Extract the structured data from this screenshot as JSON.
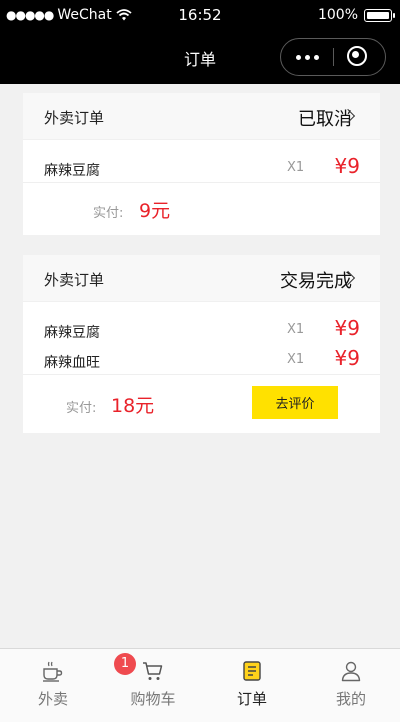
{
  "status_bar": {
    "carrier": "WeChat",
    "time": "16:52",
    "battery": "100%"
  },
  "nav": {
    "title": "订单"
  },
  "orders": [
    {
      "type": "外卖订单",
      "status": "已取消",
      "items": [
        {
          "name": "麻辣豆腐",
          "qty": "X1",
          "price": "¥9"
        }
      ],
      "paid_label": "实付:",
      "paid_amount": "9元"
    },
    {
      "type": "外卖订单",
      "status": "交易完成",
      "items": [
        {
          "name": "麻辣豆腐",
          "qty": "X1",
          "price": "¥9"
        },
        {
          "name": "麻辣血旺",
          "qty": "X1",
          "price": "¥9"
        }
      ],
      "paid_label": "实付:",
      "paid_amount": "18元",
      "action": "去评价"
    }
  ],
  "tabbar": {
    "tabs": [
      {
        "label": "外卖",
        "icon": "coffee-cup-icon"
      },
      {
        "label": "购物车",
        "icon": "shopping-cart-icon",
        "badge": "1"
      },
      {
        "label": "订单",
        "icon": "order-document-icon",
        "active": true
      },
      {
        "label": "我的",
        "icon": "user-profile-icon"
      }
    ]
  },
  "colors": {
    "price_red": "#e9222a",
    "accent_yellow": "#ffe100",
    "badge_red": "#ef4a4f"
  }
}
